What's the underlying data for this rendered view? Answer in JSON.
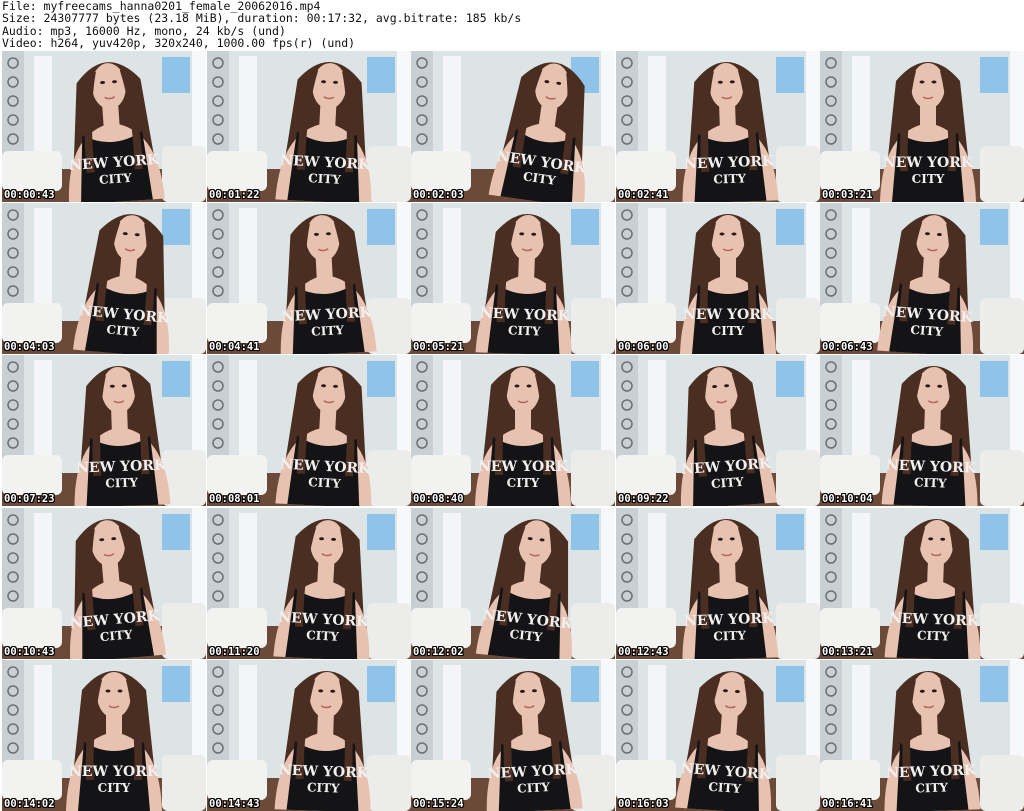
{
  "header": {
    "file": "File: myfreecams_hanna0201_female_20062016.mp4",
    "size": "Size: 24307777 bytes (23.18 MiB), duration: 00:17:32, avg.bitrate: 185 kb/s",
    "audio": "Audio: mp3, 16000 Hz, mono, 24 kb/s (und)",
    "video": "Video: h264, yuv420p, 320x240, 1000.00 fps(r) (und)"
  },
  "thumbnails": [
    {
      "time": "00:00:43"
    },
    {
      "time": "00:01:22"
    },
    {
      "time": "00:02:03"
    },
    {
      "time": "00:02:41"
    },
    {
      "time": "00:03:21"
    },
    {
      "time": "00:04:03"
    },
    {
      "time": "00:04:41"
    },
    {
      "time": "00:05:21"
    },
    {
      "time": "00:06:00"
    },
    {
      "time": "00:06:43"
    },
    {
      "time": "00:07:23"
    },
    {
      "time": "00:08:01"
    },
    {
      "time": "00:08:40"
    },
    {
      "time": "00:09:22"
    },
    {
      "time": "00:10:04"
    },
    {
      "time": "00:10:43"
    },
    {
      "time": "00:11:20"
    },
    {
      "time": "00:12:02"
    },
    {
      "time": "00:12:43"
    },
    {
      "time": "00:13:21"
    },
    {
      "time": "00:14:02"
    },
    {
      "time": "00:14:43"
    },
    {
      "time": "00:15:24"
    },
    {
      "time": "00:16:03"
    },
    {
      "time": "00:16:41"
    }
  ],
  "shirt_text": [
    "NEW YORK",
    "CITY"
  ],
  "colors": {
    "wall": "#dde4e6",
    "floor": "#6b4a3a",
    "hair": "#4a2e22",
    "skin": "#e8c2b0",
    "shirt": "#141416"
  }
}
